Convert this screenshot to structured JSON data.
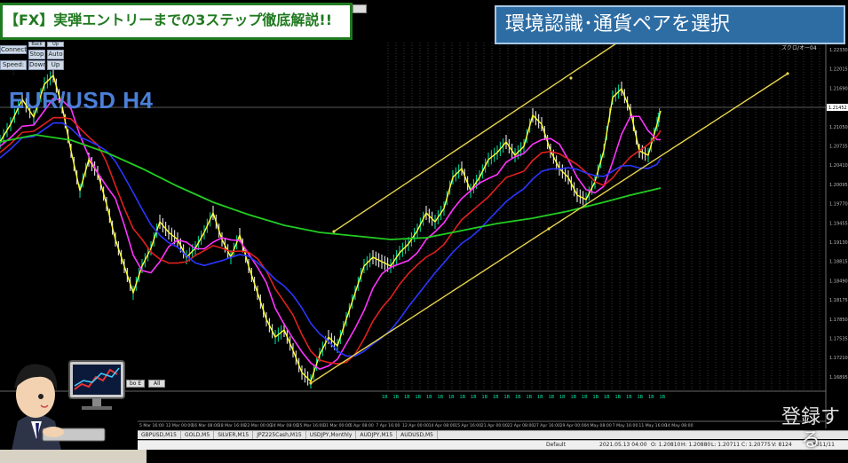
{
  "banner": {
    "title": "【FX】実弾エントリーまでの3ステップ徹底解説!!",
    "step": "環境認識･通貨ペアを選択"
  },
  "chart": {
    "symbol_label": "EUR/USD H4",
    "price_ticks": [
      "1.22330",
      "1.22015",
      "1.21690",
      "1.21375",
      "1.21050",
      "1.20735",
      "1.20410",
      "1.20095",
      "1.19770",
      "1.19455",
      "1.19130",
      "1.18815",
      "1.18490",
      "1.18175",
      "1.17850",
      "1.17535",
      "1.17210",
      "1.16895"
    ],
    "bid_label": "1.21452",
    "date_ticks": [
      "5 Mar 16:00",
      "12 Mar 00:00",
      "16 Mar 08:00",
      "18 Mar 16:00",
      "22 Mar 00:00",
      "24 Mar 08:00",
      "25 Mar 16:00",
      "31 Mar 00:00",
      "5 Apr 08:00",
      "7 Apr 16:00",
      "12 Apr 00:00",
      "14 Apr 08:00",
      "15 Apr 16:00",
      "21 Apr 00:00",
      "22 Apr 08:00",
      "27 Apr 16:00",
      "29 Apr 00:00",
      "4 May 08:00",
      "7 May 16:00",
      "11 May 16:00",
      "14 May 08:00"
    ],
    "corner_text": "ズクロ/オー04"
  },
  "controls": {
    "connect": "Connect",
    "back": "Back",
    "up": "Up",
    "stop": "Stop",
    "auto": "Auto",
    "speed": "Speed: 1",
    "down": "Down",
    "up2": "Up"
  },
  "mini_tabs": {
    "period": "bo E",
    "all": "All"
  },
  "tabs": [
    "GBPUSD,M15",
    "GOLD,M5",
    "SILVER,M15",
    "JPZ225Cash,M15",
    "USDJPY,Monthly",
    "AUDJPY,M15",
    "AUDUSD,M5"
  ],
  "status": {
    "profile": "Default",
    "time": "2021.05.13 04:00",
    "open": "O: 1.20810",
    "high": "H: 1.20880",
    "low": "L: 1.20711",
    "close": "C: 1.20775",
    "volume": "V: 8124",
    "connection": "8011/11"
  },
  "overlay": {
    "register": "登録する"
  },
  "colors": {
    "ma_fast": "#ffff33",
    "ma_magenta": "#ff33ff",
    "ma_red": "#e02020",
    "ma_blue": "#2a36ff",
    "ma_green": "#22cc22",
    "channel": "#e8d44d",
    "bar_up": "#00e6a8",
    "bar_down": "#ffffff"
  }
}
